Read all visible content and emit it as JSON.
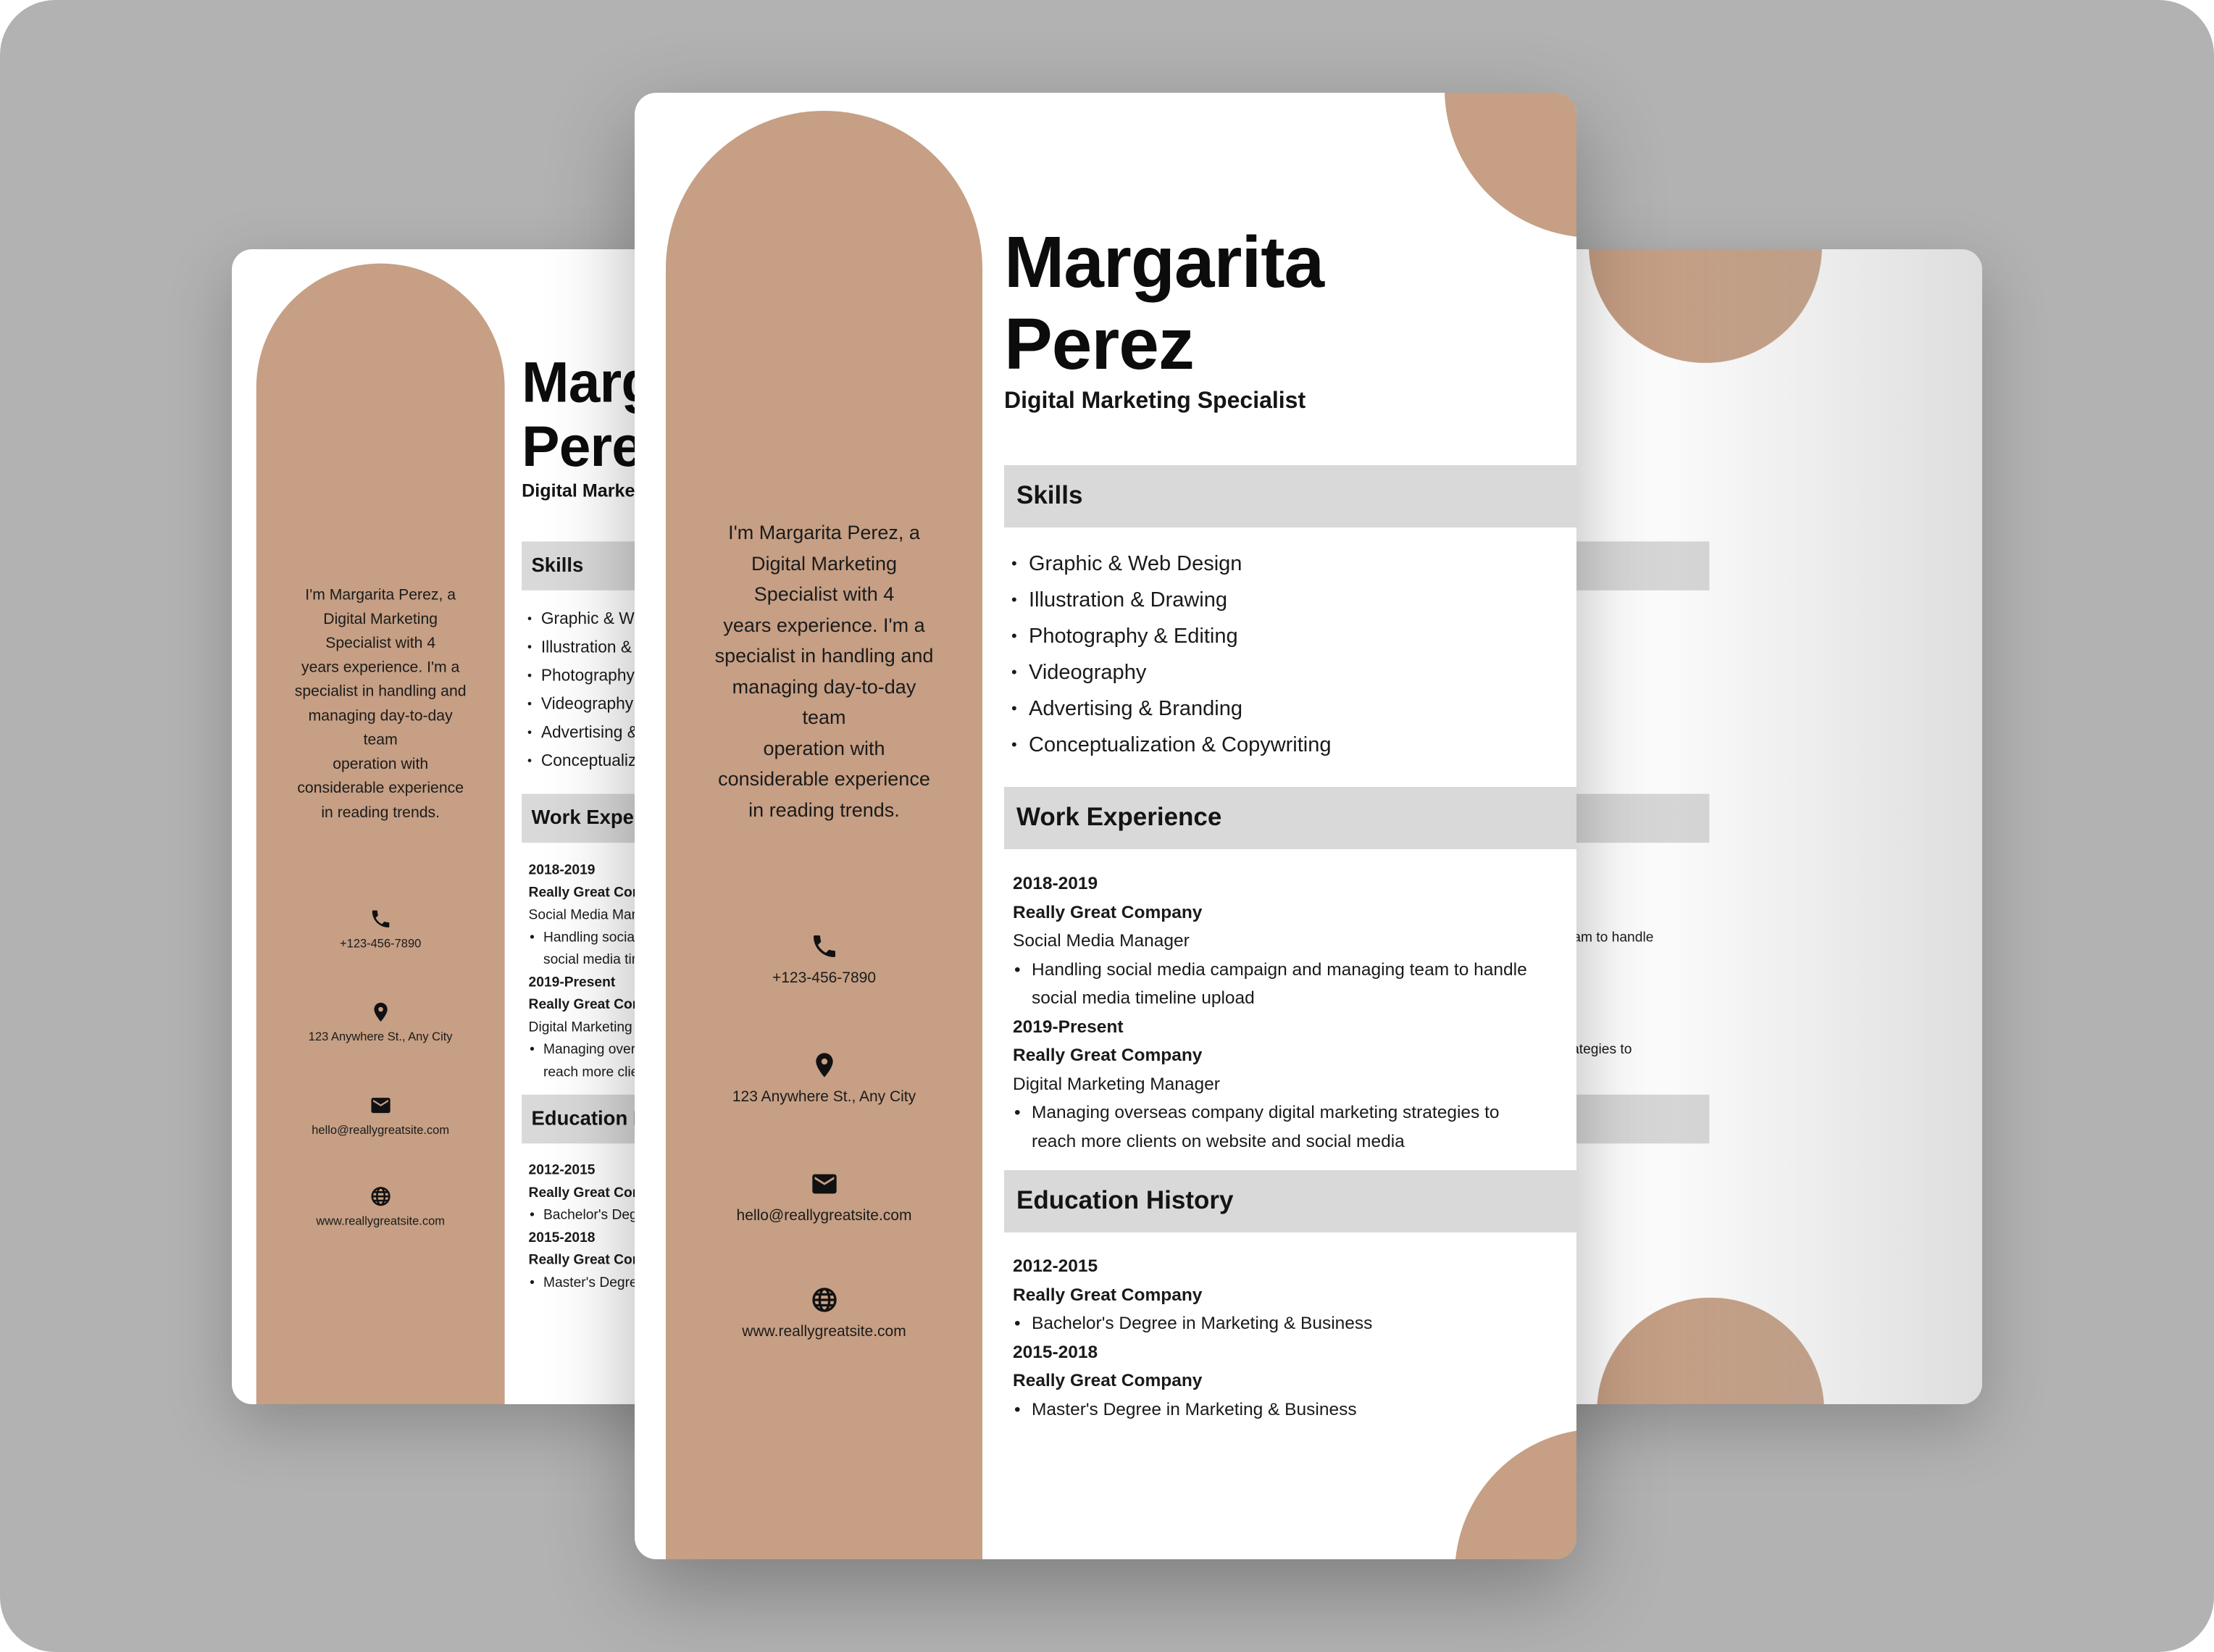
{
  "resume": {
    "name_line1": "Margarita",
    "name_line2": "Perez",
    "title": "Digital Marketing Specialist",
    "intro": [
      "I'm Margarita Perez, a",
      "Digital Marketing",
      "Specialist with 4",
      "years experience. I'm a",
      "specialist in handling and",
      "managing day-to-day",
      "team",
      "operation with",
      "considerable experience",
      "in reading trends."
    ],
    "contacts": [
      {
        "icon": "phone-icon",
        "text": "+123-456-7890"
      },
      {
        "icon": "location-pin-icon",
        "text": "123 Anywhere St., Any City"
      },
      {
        "icon": "mail-icon",
        "text": "hello@reallygreatsite.com"
      },
      {
        "icon": "globe-icon",
        "text": "www.reallygreatsite.com"
      }
    ],
    "skills_heading": "Skills",
    "skills": [
      "Graphic & Web Design",
      "Illustration & Drawing",
      "Photography & Editing",
      "Videography",
      "Advertising & Branding",
      "Conceptualization & Copywriting"
    ],
    "work_heading": "Work Experience",
    "work": [
      {
        "years": "2018-2019",
        "company": "Really Great Company",
        "role": "Social Media Manager",
        "desc_lines": [
          "Handling social media campaign and managing team to handle",
          "social media timeline upload"
        ]
      },
      {
        "years": "2019-Present",
        "company": "Really Great Company",
        "role": "Digital Marketing Manager",
        "desc_lines": [
          "Managing overseas company digital marketing strategies to",
          "reach more clients on website and social media"
        ]
      }
    ],
    "education_heading": "Education History",
    "education": [
      {
        "years": "2012-2015",
        "company": "Really Great Company",
        "degree": "Bachelor's Degree in Marketing & Business"
      },
      {
        "years": "2015-2018",
        "company": "Really Great Company",
        "degree": "Master's Degree in Marketing & Business"
      }
    ]
  },
  "colors": {
    "accent": "#c69f84",
    "section_bar": "#d9d9d9",
    "backdrop": "#b2b2b2"
  }
}
